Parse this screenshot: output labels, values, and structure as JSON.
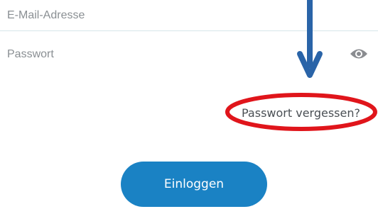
{
  "form": {
    "email_placeholder": "E-Mail-Adresse",
    "password_placeholder": "Passwort",
    "password_visibility_icon": "eye-icon",
    "forgot_password_label": "Passwort vergessen?",
    "login_button_label": "Einloggen"
  },
  "annotation": {
    "arrow_icon": "down-arrow",
    "arrow_color": "#2a64a8",
    "ellipse_color": "#e0151b"
  },
  "colors": {
    "button": "#1a82c4",
    "divider": "#d7e6ea",
    "placeholder": "#8a8f93"
  }
}
